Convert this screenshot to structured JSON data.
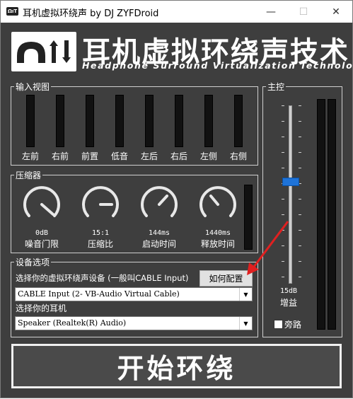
{
  "window": {
    "title": "耳机虚拟环绕声 by DJ ZYFDroid",
    "icon_text": "ΩıT"
  },
  "banner": {
    "title": "耳机虚拟环绕声技术",
    "subtitle": "Headphone Surround Virtualization Technology"
  },
  "input_view": {
    "legend": "输入视图",
    "channels": [
      "左前",
      "右前",
      "前置",
      "低音",
      "左后",
      "右后",
      "左侧",
      "右侧"
    ]
  },
  "compressor": {
    "legend": "压缩器",
    "knobs": [
      {
        "value": "0dB",
        "label": "噪音门限"
      },
      {
        "value": "15:1",
        "label": "压缩比"
      },
      {
        "value": "144ms",
        "label": "启动时间"
      },
      {
        "value": "1440ms",
        "label": "释放时间"
      }
    ]
  },
  "device": {
    "legend": "设备选项",
    "prompt": "选择你的虚拟环绕声设备 (一般叫CABLE Input)",
    "config_button": "如何配置",
    "selected_device": "CABLE Input (2- VB-Audio Virtual Cable)",
    "headphone_prompt": "选择你的耳机",
    "selected_headphone": "Speaker (Realtek(R) Audio)"
  },
  "master": {
    "legend": "主控",
    "gain_value": "15dB",
    "gain_label": "增益",
    "bypass_label": "旁路",
    "bypass_checked": false
  },
  "start_button": "开始环绕",
  "colors": {
    "background": "#3e3e3e",
    "accent": "#1e73d8",
    "arrow": "#e02020"
  }
}
